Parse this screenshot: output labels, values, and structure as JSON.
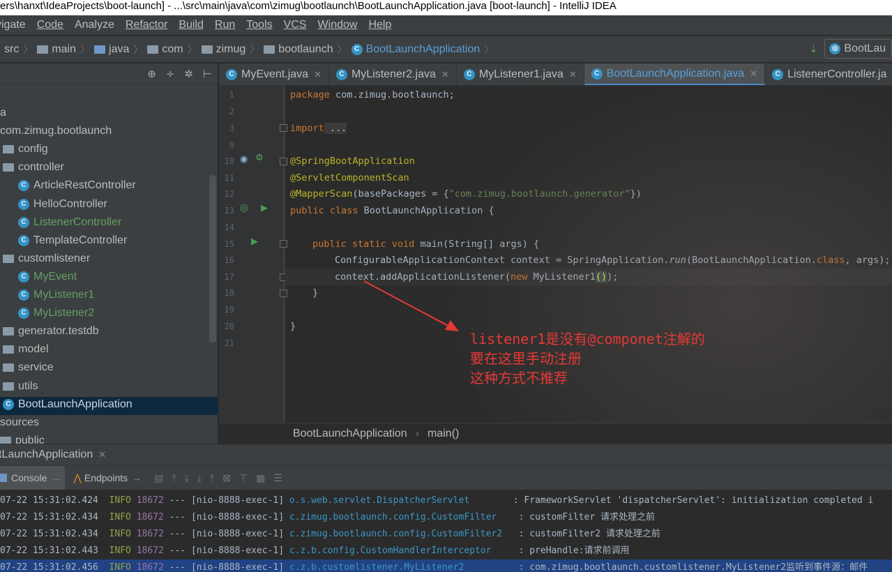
{
  "window": {
    "title": "ers\\hanxt\\IdeaProjects\\boot-launch] - ...\\src\\main\\java\\com\\zimug\\bootlaunch\\BootLaunchApplication.java [boot-launch] - IntelliJ IDEA"
  },
  "menu": [
    "vigate",
    "Code",
    "Analyze",
    "Refactor",
    "Build",
    "Run",
    "Tools",
    "VCS",
    "Window",
    "Help"
  ],
  "nav": {
    "crumbs": [
      "src",
      "main",
      "java",
      "com",
      "zimug",
      "bootlaunch",
      "BootLaunchApplication"
    ],
    "run_config": "BootLau"
  },
  "tree": [
    {
      "label": "a",
      "type": "text",
      "indent": 0
    },
    {
      "label": "com.zimug.bootlaunch",
      "type": "text",
      "indent": 0
    },
    {
      "label": "config",
      "type": "pkg",
      "indent": 1
    },
    {
      "label": "controller",
      "type": "pkg",
      "indent": 1
    },
    {
      "label": "ArticleRestController",
      "type": "cls",
      "indent": 2
    },
    {
      "label": "HelloController",
      "type": "cls",
      "indent": 2
    },
    {
      "label": "ListenerController",
      "type": "cls-green",
      "indent": 2
    },
    {
      "label": "TemplateController",
      "type": "cls",
      "indent": 2
    },
    {
      "label": "customlistener",
      "type": "pkg",
      "indent": 1
    },
    {
      "label": "MyEvent",
      "type": "cls-green",
      "indent": 2
    },
    {
      "label": "MyListener1",
      "type": "cls-green",
      "indent": 2
    },
    {
      "label": "MyListener2",
      "type": "cls-green",
      "indent": 2
    },
    {
      "label": "generator.testdb",
      "type": "pkg",
      "indent": 1
    },
    {
      "label": "model",
      "type": "pkg",
      "indent": 1
    },
    {
      "label": "service",
      "type": "pkg",
      "indent": 1
    },
    {
      "label": "utils",
      "type": "pkg",
      "indent": 1
    },
    {
      "label": "BootLaunchApplication",
      "type": "app",
      "indent": 1
    },
    {
      "label": "sources",
      "type": "text",
      "indent": 0
    },
    {
      "label": "public",
      "type": "pkg",
      "indent": 0
    }
  ],
  "tabs": [
    {
      "label": "MyEvent.java",
      "active": false
    },
    {
      "label": "MyListener2.java",
      "active": false
    },
    {
      "label": "MyListener1.java",
      "active": false
    },
    {
      "label": "BootLaunchApplication.java",
      "active": true
    },
    {
      "label": "ListenerController.ja",
      "active": false
    }
  ],
  "code": {
    "line_numbers": [
      "1",
      "2",
      "3",
      "9",
      "10",
      "11",
      "12",
      "13",
      "14",
      "15",
      "16",
      "17",
      "18",
      "19",
      "20",
      "21"
    ],
    "l1_kw": "package",
    "l1_rest": " com.zimug.bootlaunch;",
    "l3_kw": "import",
    "l3_rest": " ...",
    "l10": "@SpringBootApplication",
    "l11": "@ServletComponentScan",
    "l12_ann": "@MapperScan",
    "l12_a": "(basePackages = {",
    "l12_str": "\"com.zimug.bootlaunch.generator\"",
    "l12_b": "})",
    "l13_kw": "public class",
    "l13_rest": " BootLaunchApplication {",
    "l15_kw": "public static void",
    "l15_rest": " main(String[] args) {",
    "l16_a": "ConfigurableApplicationContext context = SpringApplication.",
    "l16_it": "run",
    "l16_b": "(BootLaunchApplication.",
    "l16_kw": "class",
    "l16_c": ", args);",
    "l17_a": "context.addApplicationListener(",
    "l17_kw": "new",
    "l17_b": " MyListener1",
    "l17_paren": "()",
    "l17_c": ");",
    "l18": "}",
    "l20": "}"
  },
  "annotation": {
    "line1": "listener1是没有@componet注解的",
    "line2": "要在这里手动注册",
    "line3": "这种方式不推荐",
    "color": "#e53935"
  },
  "editor_breadcrumb": [
    "BootLaunchApplication",
    "main()"
  ],
  "run_panel": {
    "title": "tLaunchApplication",
    "console_tab": "Console",
    "endpoints_tab": "Endpoints"
  },
  "console_lines": [
    {
      "date": "07-22 15:31:02.424",
      "level": "INFO",
      "pid": "18672",
      "sep": "---",
      "thread": "[nio-8888-exec-1]",
      "logger": "o.s.web.servlet.DispatcherServlet       ",
      "msg": ": FrameworkServlet 'dispatcherServlet': initialization completed i"
    },
    {
      "date": "07-22 15:31:02.434",
      "level": "INFO",
      "pid": "18672",
      "sep": "---",
      "thread": "[nio-8888-exec-1]",
      "logger": "c.zimug.bootlaunch.config.CustomFilter   ",
      "msg": ": customFilter 请求处理之前"
    },
    {
      "date": "07-22 15:31:02.434",
      "level": "INFO",
      "pid": "18672",
      "sep": "---",
      "thread": "[nio-8888-exec-1]",
      "logger": "c.zimug.bootlaunch.config.CustomFilter2  ",
      "msg": ": customFilter2 请求处理之前"
    },
    {
      "date": "07-22 15:31:02.443",
      "level": "INFO",
      "pid": "18672",
      "sep": "---",
      "thread": "[nio-8888-exec-1]",
      "logger": "c.z.b.config.CustomHandlerInterceptor    ",
      "msg": ": preHandle:请求前调用"
    },
    {
      "date": "07-22 15:31:02.456",
      "level": "INFO",
      "pid": "18672",
      "sep": "---",
      "thread": "[nio-8888-exec-1]",
      "logger": "c.z.b.customlistener.MyListener2         ",
      "msg": ": com.zimug.bootlaunch.customlistener.MyListener2监听到事件源：邮件"
    }
  ]
}
